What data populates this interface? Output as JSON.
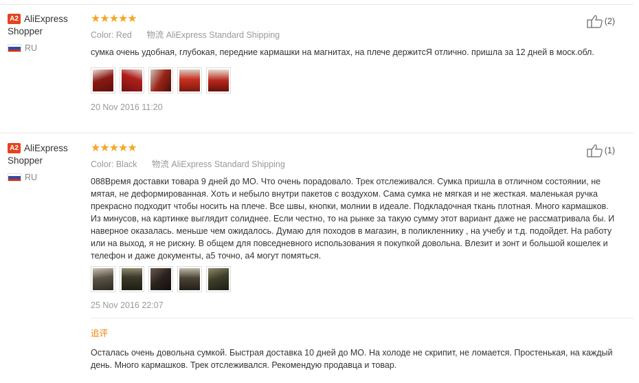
{
  "reviews": [
    {
      "user": {
        "badge": "A2",
        "name_line1": "AliExpress",
        "name_line2": "Shopper",
        "country": "RU"
      },
      "stars": "★★★★★",
      "color_label": "Color:",
      "color_value": "Red",
      "shipping_label": "物流",
      "shipping_value": "AliExpress Standard Shipping",
      "text": "сумка очень удобная, глубокая, передние кармашки на магнитах, на плече держитсЯ отлично. пришла за 12 дней в моск.обл.",
      "date": "20 Nov 2016 11:20",
      "helpful_count": "(2)",
      "photos": [
        "#8b1a14",
        "#b01f1c",
        "#9a2418",
        "#c9301f",
        "#b8281c"
      ]
    },
    {
      "user": {
        "badge": "A2",
        "name_line1": "AliExpress",
        "name_line2": "Shopper",
        "country": "RU"
      },
      "stars": "★★★★★",
      "color_label": "Color:",
      "color_value": "Black",
      "shipping_label": "物流",
      "shipping_value": "AliExpress Standard Shipping",
      "text": "088Время доставки товара 9 дней до МО. Что очень порадовало. Трек отслеживался. Сумка пришла в отличном состоянии, не мятая, не деформированная. Хоть и небыло внутри пакетов с воздухом. Сама сумка не мягкая и не жесткая. маленькая ручка прекрасно подходит чтобы носить на плече. Все швы, кнопки, молнии в идеале. Подкладочная ткань плотная. Много кармашков. Из минусов, на картинке выглядит солиднее. Если честно, то на рынке за такую сумму этот вариант даже не рассматривала бы. И наверное оказалась. меньше чем ожидалось. Думаю для походов в магазин, в поликленнику , на учебу и т.д. подойдет. На работу или на выход, я не рискну. В общем для повседневного использования я покупкой довольна. Влезит и зонт и большой кошелек и телефон и даже документы, а5 точно, а4 могут помяться.",
      "date": "25 Nov 2016 22:07",
      "helpful_count": "(1)",
      "photos": [
        "#5a5346",
        "#3d3a2a",
        "#2a211c",
        "#4a4436",
        "#3f3f2c"
      ],
      "additional_title": "追评",
      "additional_text": "Осталась очень довольна сумкой. Быстрая доставка 10 дней до МО. На холоде не скрипит, не ломается. Простенькая, на каждый день. Много кармашков. Трек отслеживался. Рекомендую продавца и товар."
    }
  ]
}
